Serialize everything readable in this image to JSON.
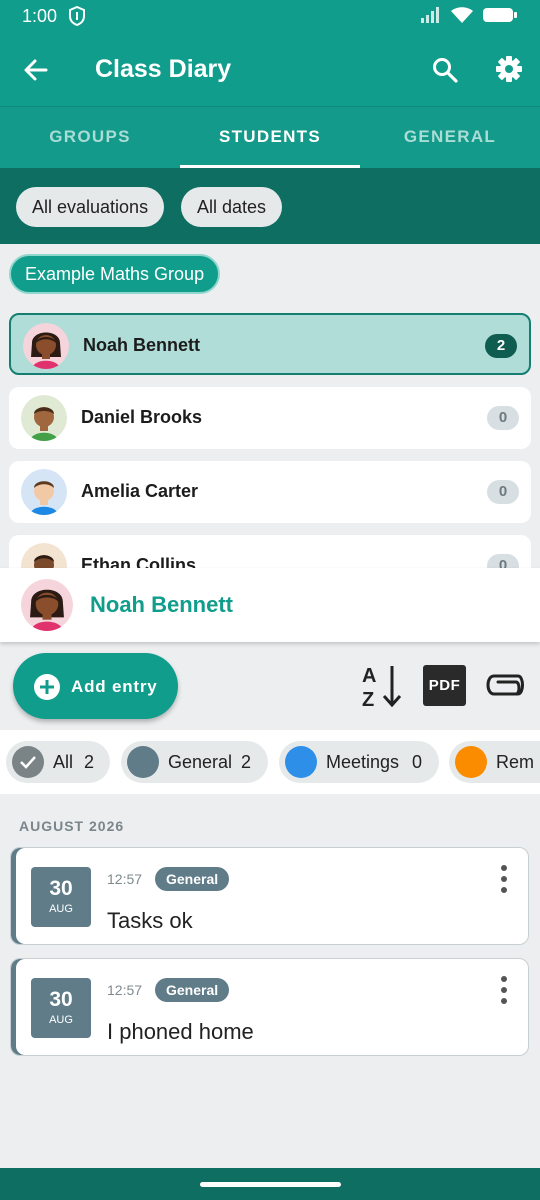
{
  "status_bar": {
    "time": "1:00"
  },
  "app_bar": {
    "title": "Class Diary"
  },
  "tabs": [
    {
      "label": "GROUPS"
    },
    {
      "label": "STUDENTS",
      "active": true
    },
    {
      "label": "GENERAL"
    }
  ],
  "filters": {
    "evaluations": "All evaluations",
    "dates": "All dates"
  },
  "group": {
    "label": "Example Maths Group"
  },
  "students": [
    {
      "name": "Noah Bennett",
      "count": "2",
      "selected": true
    },
    {
      "name": "Daniel Brooks",
      "count": "0"
    },
    {
      "name": "Amelia Carter",
      "count": "0"
    },
    {
      "name": "Ethan Collins",
      "count": "0"
    }
  ],
  "selected_student": {
    "name": "Noah Bennett"
  },
  "actions": {
    "add_entry": "Add entry",
    "pdf": "PDF"
  },
  "categories": [
    {
      "label": "All",
      "count": "2",
      "color": "#7a8386"
    },
    {
      "label": "General",
      "count": "2",
      "color": "#5f7c88"
    },
    {
      "label": "Meetings",
      "count": "0",
      "color": "#2d8fe8"
    },
    {
      "label": "Rem",
      "count": "",
      "color": "#fb8c00"
    }
  ],
  "month_header": "AUGUST 2026",
  "entries": [
    {
      "day": "30",
      "month": "AUG",
      "time": "12:57",
      "tag": "General",
      "text": "Tasks ok"
    },
    {
      "day": "30",
      "month": "AUG",
      "time": "12:57",
      "tag": "General",
      "text": "I phoned home"
    }
  ],
  "colors": {
    "primary": "#119d8c",
    "dark": "#0d6e61",
    "slate": "#5f7c88"
  }
}
